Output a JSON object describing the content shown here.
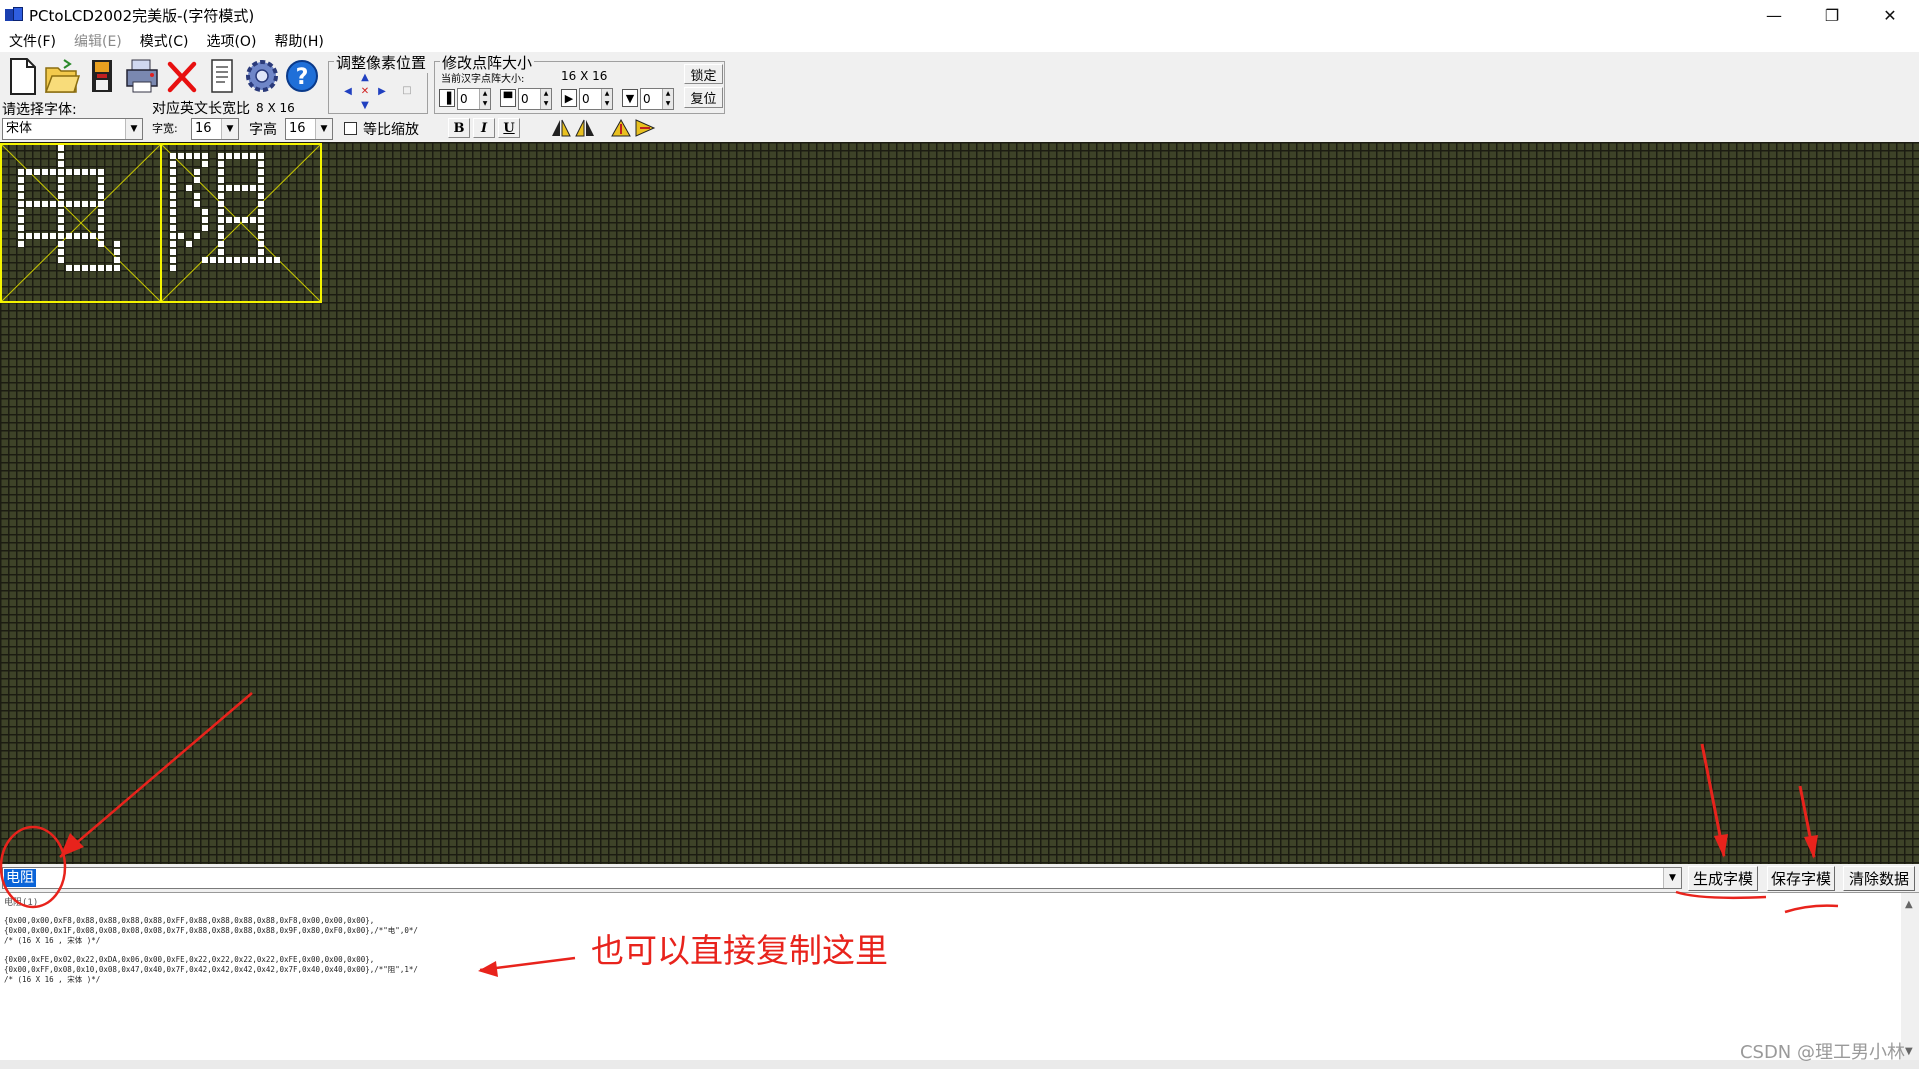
{
  "window": {
    "title": "PCtoLCD2002完美版-(字符模式)",
    "controls": {
      "minimize": "—",
      "restore": "❐",
      "close": "✕"
    }
  },
  "menu": [
    {
      "label": "文件(F)",
      "enabled": true
    },
    {
      "label": "编辑(E)",
      "enabled": false
    },
    {
      "label": "模式(C)",
      "enabled": true
    },
    {
      "label": "选项(O)",
      "enabled": true
    },
    {
      "label": "帮助(H)",
      "enabled": true
    }
  ],
  "toolbar": {
    "icons": [
      "new-file-icon",
      "open-folder-icon",
      "save-disk-icon",
      "print-icon",
      "delete-x-icon",
      "document-icon",
      "settings-gear-icon",
      "help-question-icon"
    ],
    "font_label": "请选择字体:",
    "font_value": "宋体",
    "ratio_label": "对应英文长宽比",
    "ratio_value": "8 X 16",
    "width_label": "字宽:",
    "width_value": "16",
    "height_label": "字高",
    "height_value": "16",
    "proportional_label": "等比缩放",
    "adjust_group_title": "调整像素位置",
    "resize_group_title": "修改点阵大小",
    "current_size_label": "当前汉字点阵大小:",
    "current_size_value": "16 X 16",
    "lock_button": "锁定",
    "reset_button": "复位",
    "spin_values": [
      "0",
      "0",
      "0",
      "0"
    ],
    "format_buttons": [
      "B",
      "I",
      "U"
    ]
  },
  "colors": {
    "matrix_bg": "#3e4328",
    "grid_line": "#1c1c12",
    "lit_dot": "#ffffff",
    "char_border": "#f5f500",
    "annotation": "#e8231c",
    "selection": "#0a64d8"
  },
  "editor": {
    "input_text": "电阻",
    "buttons": {
      "generate": "生成字模",
      "save": "保存字模",
      "clear": "清除数据"
    }
  },
  "output": {
    "header": "电阻(1)",
    "blocks": [
      [
        "{0x00,0x00,0xF8,0x88,0x88,0x88,0x88,0xFF,0x88,0x88,0x88,0x88,0xF8,0x00,0x00,0x00},",
        "{0x00,0x00,0x1F,0x08,0x08,0x08,0x08,0x7F,0x88,0x88,0x88,0x88,0x9F,0x80,0xF0,0x00},/*\"电\",0*/",
        "/* (16 X 16 , 宋体 )*/"
      ],
      [
        "{0x00,0xFE,0x02,0x22,0xDA,0x06,0x00,0xFE,0x22,0x22,0x22,0x22,0xFE,0x00,0x00,0x00},",
        "{0x00,0xFF,0x08,0x10,0x08,0x47,0x40,0x7F,0x42,0x42,0x42,0x42,0x7F,0x40,0x40,0x00},/*\"阻\",1*/",
        "/* (16 X 16 , 宋体 )*/"
      ]
    ]
  },
  "annotation": {
    "text": "也可以直接复制这里"
  },
  "watermark": "CSDN @理工男小林"
}
